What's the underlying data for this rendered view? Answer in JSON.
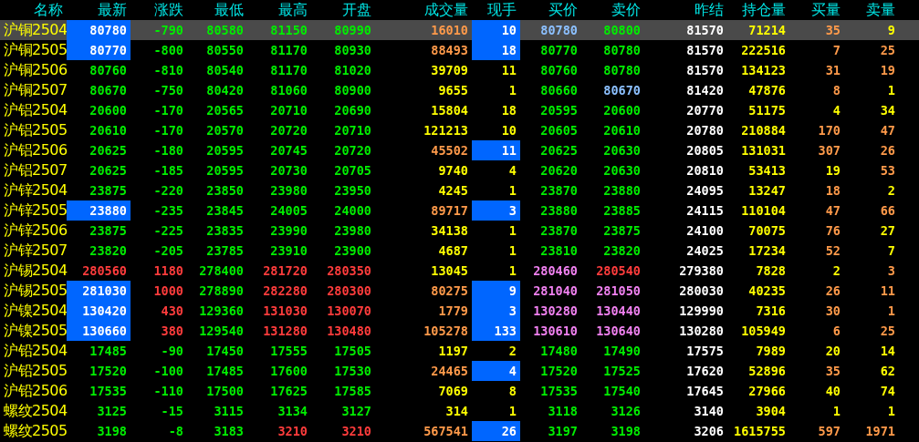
{
  "columns": [
    "名称",
    "最新",
    "涨跌",
    "最低",
    "最高",
    "开盘",
    "成交量",
    "现手",
    "买价",
    "卖价",
    "昨结",
    "持仓量",
    "买量",
    "卖量"
  ],
  "rows": [
    {
      "name": "沪铜2504",
      "selected": true,
      "cells": [
        {
          "text": "80780",
          "color": "#ffffff",
          "flash": true
        },
        {
          "text": "-790",
          "color": "#00ee00",
          "flash": false
        },
        {
          "text": "80580",
          "color": "#00ee00",
          "flash": false
        },
        {
          "text": "81150",
          "color": "#00ee00",
          "flash": false
        },
        {
          "text": "80990",
          "color": "#00ee00",
          "flash": false
        },
        {
          "text": "16010",
          "color": "#ff9a4a",
          "flash": false
        },
        {
          "text": "10",
          "color": "#ffffff",
          "flash": true
        },
        {
          "text": "80780",
          "color": "#8cc0ff",
          "flash": false
        },
        {
          "text": "80800",
          "color": "#00ee00",
          "flash": false
        },
        {
          "text": "81570",
          "color": "#ffffff",
          "flash": false
        },
        {
          "text": "71214",
          "color": "#ffff00",
          "flash": false
        },
        {
          "text": "35",
          "color": "#ff9a4a",
          "flash": false
        },
        {
          "text": "9",
          "color": "#ffff00",
          "flash": false
        }
      ]
    },
    {
      "name": "沪铜2505",
      "selected": false,
      "cells": [
        {
          "text": "80770",
          "color": "#ffffff",
          "flash": true
        },
        {
          "text": "-800",
          "color": "#00ee00",
          "flash": false
        },
        {
          "text": "80550",
          "color": "#00ee00",
          "flash": false
        },
        {
          "text": "81170",
          "color": "#00ee00",
          "flash": false
        },
        {
          "text": "80930",
          "color": "#00ee00",
          "flash": false
        },
        {
          "text": "88493",
          "color": "#ff9a4a",
          "flash": false
        },
        {
          "text": "18",
          "color": "#ffffff",
          "flash": true
        },
        {
          "text": "80770",
          "color": "#00ee00",
          "flash": false
        },
        {
          "text": "80780",
          "color": "#00ee00",
          "flash": false
        },
        {
          "text": "81570",
          "color": "#ffffff",
          "flash": false
        },
        {
          "text": "222516",
          "color": "#ffff00",
          "flash": false
        },
        {
          "text": "7",
          "color": "#ff9a4a",
          "flash": false
        },
        {
          "text": "25",
          "color": "#ff9a4a",
          "flash": false
        }
      ]
    },
    {
      "name": "沪铜2506",
      "selected": false,
      "cells": [
        {
          "text": "80760",
          "color": "#00ee00",
          "flash": false
        },
        {
          "text": "-810",
          "color": "#00ee00",
          "flash": false
        },
        {
          "text": "80540",
          "color": "#00ee00",
          "flash": false
        },
        {
          "text": "81170",
          "color": "#00ee00",
          "flash": false
        },
        {
          "text": "81020",
          "color": "#00ee00",
          "flash": false
        },
        {
          "text": "39709",
          "color": "#ffff00",
          "flash": false
        },
        {
          "text": "11",
          "color": "#ffff00",
          "flash": false
        },
        {
          "text": "80760",
          "color": "#00ee00",
          "flash": false
        },
        {
          "text": "80780",
          "color": "#00ee00",
          "flash": false
        },
        {
          "text": "81570",
          "color": "#ffffff",
          "flash": false
        },
        {
          "text": "134123",
          "color": "#ffff00",
          "flash": false
        },
        {
          "text": "31",
          "color": "#ff9a4a",
          "flash": false
        },
        {
          "text": "19",
          "color": "#ff9a4a",
          "flash": false
        }
      ]
    },
    {
      "name": "沪铜2507",
      "selected": false,
      "cells": [
        {
          "text": "80670",
          "color": "#00ee00",
          "flash": false
        },
        {
          "text": "-750",
          "color": "#00ee00",
          "flash": false
        },
        {
          "text": "80420",
          "color": "#00ee00",
          "flash": false
        },
        {
          "text": "81060",
          "color": "#00ee00",
          "flash": false
        },
        {
          "text": "80900",
          "color": "#00ee00",
          "flash": false
        },
        {
          "text": "9655",
          "color": "#ffff00",
          "flash": false
        },
        {
          "text": "1",
          "color": "#ffff00",
          "flash": false
        },
        {
          "text": "80660",
          "color": "#00ee00",
          "flash": false
        },
        {
          "text": "80670",
          "color": "#8cc0ff",
          "flash": false
        },
        {
          "text": "81420",
          "color": "#ffffff",
          "flash": false
        },
        {
          "text": "47876",
          "color": "#ffff00",
          "flash": false
        },
        {
          "text": "8",
          "color": "#ff9a4a",
          "flash": false
        },
        {
          "text": "1",
          "color": "#ffff00",
          "flash": false
        }
      ]
    },
    {
      "name": "沪铝2504",
      "selected": false,
      "cells": [
        {
          "text": "20600",
          "color": "#00ee00",
          "flash": false
        },
        {
          "text": "-170",
          "color": "#00ee00",
          "flash": false
        },
        {
          "text": "20565",
          "color": "#00ee00",
          "flash": false
        },
        {
          "text": "20710",
          "color": "#00ee00",
          "flash": false
        },
        {
          "text": "20690",
          "color": "#00ee00",
          "flash": false
        },
        {
          "text": "15804",
          "color": "#ffff00",
          "flash": false
        },
        {
          "text": "18",
          "color": "#ffff00",
          "flash": false
        },
        {
          "text": "20595",
          "color": "#00ee00",
          "flash": false
        },
        {
          "text": "20600",
          "color": "#00ee00",
          "flash": false
        },
        {
          "text": "20770",
          "color": "#ffffff",
          "flash": false
        },
        {
          "text": "51175",
          "color": "#ffff00",
          "flash": false
        },
        {
          "text": "4",
          "color": "#ffff00",
          "flash": false
        },
        {
          "text": "34",
          "color": "#ffff00",
          "flash": false
        }
      ]
    },
    {
      "name": "沪铝2505",
      "selected": false,
      "cells": [
        {
          "text": "20610",
          "color": "#00ee00",
          "flash": false
        },
        {
          "text": "-170",
          "color": "#00ee00",
          "flash": false
        },
        {
          "text": "20570",
          "color": "#00ee00",
          "flash": false
        },
        {
          "text": "20720",
          "color": "#00ee00",
          "flash": false
        },
        {
          "text": "20710",
          "color": "#00ee00",
          "flash": false
        },
        {
          "text": "121213",
          "color": "#ffff00",
          "flash": false
        },
        {
          "text": "10",
          "color": "#ffff00",
          "flash": false
        },
        {
          "text": "20605",
          "color": "#00ee00",
          "flash": false
        },
        {
          "text": "20610",
          "color": "#00ee00",
          "flash": false
        },
        {
          "text": "20780",
          "color": "#ffffff",
          "flash": false
        },
        {
          "text": "210884",
          "color": "#ffff00",
          "flash": false
        },
        {
          "text": "170",
          "color": "#ff9a4a",
          "flash": false
        },
        {
          "text": "47",
          "color": "#ff9a4a",
          "flash": false
        }
      ]
    },
    {
      "name": "沪铝2506",
      "selected": false,
      "cells": [
        {
          "text": "20625",
          "color": "#00ee00",
          "flash": false
        },
        {
          "text": "-180",
          "color": "#00ee00",
          "flash": false
        },
        {
          "text": "20595",
          "color": "#00ee00",
          "flash": false
        },
        {
          "text": "20745",
          "color": "#00ee00",
          "flash": false
        },
        {
          "text": "20720",
          "color": "#00ee00",
          "flash": false
        },
        {
          "text": "45502",
          "color": "#ff9a4a",
          "flash": false
        },
        {
          "text": "11",
          "color": "#ffffff",
          "flash": true
        },
        {
          "text": "20625",
          "color": "#00ee00",
          "flash": false
        },
        {
          "text": "20630",
          "color": "#00ee00",
          "flash": false
        },
        {
          "text": "20805",
          "color": "#ffffff",
          "flash": false
        },
        {
          "text": "131031",
          "color": "#ffff00",
          "flash": false
        },
        {
          "text": "307",
          "color": "#ff9a4a",
          "flash": false
        },
        {
          "text": "26",
          "color": "#ff9a4a",
          "flash": false
        }
      ]
    },
    {
      "name": "沪铝2507",
      "selected": false,
      "cells": [
        {
          "text": "20625",
          "color": "#00ee00",
          "flash": false
        },
        {
          "text": "-185",
          "color": "#00ee00",
          "flash": false
        },
        {
          "text": "20595",
          "color": "#00ee00",
          "flash": false
        },
        {
          "text": "20730",
          "color": "#00ee00",
          "flash": false
        },
        {
          "text": "20705",
          "color": "#00ee00",
          "flash": false
        },
        {
          "text": "9740",
          "color": "#ffff00",
          "flash": false
        },
        {
          "text": "4",
          "color": "#ffff00",
          "flash": false
        },
        {
          "text": "20620",
          "color": "#00ee00",
          "flash": false
        },
        {
          "text": "20630",
          "color": "#00ee00",
          "flash": false
        },
        {
          "text": "20810",
          "color": "#ffffff",
          "flash": false
        },
        {
          "text": "53413",
          "color": "#ffff00",
          "flash": false
        },
        {
          "text": "19",
          "color": "#ffff00",
          "flash": false
        },
        {
          "text": "53",
          "color": "#ff9a4a",
          "flash": false
        }
      ]
    },
    {
      "name": "沪锌2504",
      "selected": false,
      "cells": [
        {
          "text": "23875",
          "color": "#00ee00",
          "flash": false
        },
        {
          "text": "-220",
          "color": "#00ee00",
          "flash": false
        },
        {
          "text": "23850",
          "color": "#00ee00",
          "flash": false
        },
        {
          "text": "23980",
          "color": "#00ee00",
          "flash": false
        },
        {
          "text": "23950",
          "color": "#00ee00",
          "flash": false
        },
        {
          "text": "4245",
          "color": "#ffff00",
          "flash": false
        },
        {
          "text": "1",
          "color": "#ffff00",
          "flash": false
        },
        {
          "text": "23870",
          "color": "#00ee00",
          "flash": false
        },
        {
          "text": "23880",
          "color": "#00ee00",
          "flash": false
        },
        {
          "text": "24095",
          "color": "#ffffff",
          "flash": false
        },
        {
          "text": "13247",
          "color": "#ffff00",
          "flash": false
        },
        {
          "text": "18",
          "color": "#ff9a4a",
          "flash": false
        },
        {
          "text": "2",
          "color": "#ffff00",
          "flash": false
        }
      ]
    },
    {
      "name": "沪锌2505",
      "selected": false,
      "cells": [
        {
          "text": "23880",
          "color": "#ffffff",
          "flash": true
        },
        {
          "text": "-235",
          "color": "#00ee00",
          "flash": false
        },
        {
          "text": "23845",
          "color": "#00ee00",
          "flash": false
        },
        {
          "text": "24005",
          "color": "#00ee00",
          "flash": false
        },
        {
          "text": "24000",
          "color": "#00ee00",
          "flash": false
        },
        {
          "text": "89717",
          "color": "#ff9a4a",
          "flash": false
        },
        {
          "text": "3",
          "color": "#ffffff",
          "flash": true
        },
        {
          "text": "23880",
          "color": "#00ee00",
          "flash": false
        },
        {
          "text": "23885",
          "color": "#00ee00",
          "flash": false
        },
        {
          "text": "24115",
          "color": "#ffffff",
          "flash": false
        },
        {
          "text": "110104",
          "color": "#ffff00",
          "flash": false
        },
        {
          "text": "47",
          "color": "#ff9a4a",
          "flash": false
        },
        {
          "text": "66",
          "color": "#ff9a4a",
          "flash": false
        }
      ]
    },
    {
      "name": "沪锌2506",
      "selected": false,
      "cells": [
        {
          "text": "23875",
          "color": "#00ee00",
          "flash": false
        },
        {
          "text": "-225",
          "color": "#00ee00",
          "flash": false
        },
        {
          "text": "23835",
          "color": "#00ee00",
          "flash": false
        },
        {
          "text": "23990",
          "color": "#00ee00",
          "flash": false
        },
        {
          "text": "23980",
          "color": "#00ee00",
          "flash": false
        },
        {
          "text": "34138",
          "color": "#ffff00",
          "flash": false
        },
        {
          "text": "1",
          "color": "#ffff00",
          "flash": false
        },
        {
          "text": "23870",
          "color": "#00ee00",
          "flash": false
        },
        {
          "text": "23875",
          "color": "#00ee00",
          "flash": false
        },
        {
          "text": "24100",
          "color": "#ffffff",
          "flash": false
        },
        {
          "text": "70075",
          "color": "#ffff00",
          "flash": false
        },
        {
          "text": "76",
          "color": "#ff9a4a",
          "flash": false
        },
        {
          "text": "27",
          "color": "#ffff00",
          "flash": false
        }
      ]
    },
    {
      "name": "沪锌2507",
      "selected": false,
      "cells": [
        {
          "text": "23820",
          "color": "#00ee00",
          "flash": false
        },
        {
          "text": "-205",
          "color": "#00ee00",
          "flash": false
        },
        {
          "text": "23785",
          "color": "#00ee00",
          "flash": false
        },
        {
          "text": "23910",
          "color": "#00ee00",
          "flash": false
        },
        {
          "text": "23900",
          "color": "#00ee00",
          "flash": false
        },
        {
          "text": "4687",
          "color": "#ffff00",
          "flash": false
        },
        {
          "text": "1",
          "color": "#ffff00",
          "flash": false
        },
        {
          "text": "23810",
          "color": "#00ee00",
          "flash": false
        },
        {
          "text": "23820",
          "color": "#00ee00",
          "flash": false
        },
        {
          "text": "24025",
          "color": "#ffffff",
          "flash": false
        },
        {
          "text": "17234",
          "color": "#ffff00",
          "flash": false
        },
        {
          "text": "52",
          "color": "#ff9a4a",
          "flash": false
        },
        {
          "text": "7",
          "color": "#ffff00",
          "flash": false
        }
      ]
    },
    {
      "name": "沪锡2504",
      "selected": false,
      "cells": [
        {
          "text": "280560",
          "color": "#ff3c3c",
          "flash": false
        },
        {
          "text": "1180",
          "color": "#ff3c3c",
          "flash": false
        },
        {
          "text": "278400",
          "color": "#00ee00",
          "flash": false
        },
        {
          "text": "281720",
          "color": "#ff3c3c",
          "flash": false
        },
        {
          "text": "280350",
          "color": "#ff3c3c",
          "flash": false
        },
        {
          "text": "13045",
          "color": "#ffff00",
          "flash": false
        },
        {
          "text": "1",
          "color": "#ffff00",
          "flash": false
        },
        {
          "text": "280460",
          "color": "#f080f0",
          "flash": false
        },
        {
          "text": "280540",
          "color": "#ff3c3c",
          "flash": false
        },
        {
          "text": "279380",
          "color": "#ffffff",
          "flash": false
        },
        {
          "text": "7828",
          "color": "#ffff00",
          "flash": false
        },
        {
          "text": "2",
          "color": "#ffff00",
          "flash": false
        },
        {
          "text": "3",
          "color": "#ff9a4a",
          "flash": false
        }
      ]
    },
    {
      "name": "沪锡2505",
      "selected": false,
      "cells": [
        {
          "text": "281030",
          "color": "#ffffff",
          "flash": true
        },
        {
          "text": "1000",
          "color": "#ff3c3c",
          "flash": false
        },
        {
          "text": "278890",
          "color": "#00ee00",
          "flash": false
        },
        {
          "text": "282280",
          "color": "#ff3c3c",
          "flash": false
        },
        {
          "text": "280300",
          "color": "#ff3c3c",
          "flash": false
        },
        {
          "text": "80275",
          "color": "#ff9a4a",
          "flash": false
        },
        {
          "text": "9",
          "color": "#ffffff",
          "flash": true
        },
        {
          "text": "281040",
          "color": "#f080f0",
          "flash": false
        },
        {
          "text": "281050",
          "color": "#f080f0",
          "flash": false
        },
        {
          "text": "280030",
          "color": "#ffffff",
          "flash": false
        },
        {
          "text": "40235",
          "color": "#ffff00",
          "flash": false
        },
        {
          "text": "26",
          "color": "#ff9a4a",
          "flash": false
        },
        {
          "text": "11",
          "color": "#ff9a4a",
          "flash": false
        }
      ]
    },
    {
      "name": "沪镍2504",
      "selected": false,
      "cells": [
        {
          "text": "130420",
          "color": "#ffffff",
          "flash": true
        },
        {
          "text": "430",
          "color": "#ff3c3c",
          "flash": false
        },
        {
          "text": "129360",
          "color": "#00ee00",
          "flash": false
        },
        {
          "text": "131030",
          "color": "#ff3c3c",
          "flash": false
        },
        {
          "text": "130070",
          "color": "#ff3c3c",
          "flash": false
        },
        {
          "text": "1779",
          "color": "#ff9a4a",
          "flash": false
        },
        {
          "text": "3",
          "color": "#ffffff",
          "flash": true
        },
        {
          "text": "130280",
          "color": "#f080f0",
          "flash": false
        },
        {
          "text": "130440",
          "color": "#f080f0",
          "flash": false
        },
        {
          "text": "129990",
          "color": "#ffffff",
          "flash": false
        },
        {
          "text": "7316",
          "color": "#ffff00",
          "flash": false
        },
        {
          "text": "30",
          "color": "#ff9a4a",
          "flash": false
        },
        {
          "text": "1",
          "color": "#ff9a4a",
          "flash": false
        }
      ]
    },
    {
      "name": "沪镍2505",
      "selected": false,
      "cells": [
        {
          "text": "130660",
          "color": "#ffffff",
          "flash": true
        },
        {
          "text": "380",
          "color": "#ff3c3c",
          "flash": false
        },
        {
          "text": "129540",
          "color": "#00ee00",
          "flash": false
        },
        {
          "text": "131280",
          "color": "#ff3c3c",
          "flash": false
        },
        {
          "text": "130480",
          "color": "#ff3c3c",
          "flash": false
        },
        {
          "text": "105278",
          "color": "#ff9a4a",
          "flash": false
        },
        {
          "text": "133",
          "color": "#ffffff",
          "flash": true
        },
        {
          "text": "130610",
          "color": "#f080f0",
          "flash": false
        },
        {
          "text": "130640",
          "color": "#f080f0",
          "flash": false
        },
        {
          "text": "130280",
          "color": "#ffffff",
          "flash": false
        },
        {
          "text": "105949",
          "color": "#ffff00",
          "flash": false
        },
        {
          "text": "6",
          "color": "#ff9a4a",
          "flash": false
        },
        {
          "text": "25",
          "color": "#ff9a4a",
          "flash": false
        }
      ]
    },
    {
      "name": "沪铅2504",
      "selected": false,
      "cells": [
        {
          "text": "17485",
          "color": "#00ee00",
          "flash": false
        },
        {
          "text": "-90",
          "color": "#00ee00",
          "flash": false
        },
        {
          "text": "17450",
          "color": "#00ee00",
          "flash": false
        },
        {
          "text": "17555",
          "color": "#00ee00",
          "flash": false
        },
        {
          "text": "17505",
          "color": "#00ee00",
          "flash": false
        },
        {
          "text": "1197",
          "color": "#ffff00",
          "flash": false
        },
        {
          "text": "2",
          "color": "#ffff00",
          "flash": false
        },
        {
          "text": "17480",
          "color": "#00ee00",
          "flash": false
        },
        {
          "text": "17490",
          "color": "#00ee00",
          "flash": false
        },
        {
          "text": "17575",
          "color": "#ffffff",
          "flash": false
        },
        {
          "text": "7989",
          "color": "#ffff00",
          "flash": false
        },
        {
          "text": "20",
          "color": "#ffff00",
          "flash": false
        },
        {
          "text": "14",
          "color": "#ffff00",
          "flash": false
        }
      ]
    },
    {
      "name": "沪铅2505",
      "selected": false,
      "cells": [
        {
          "text": "17520",
          "color": "#00ee00",
          "flash": false
        },
        {
          "text": "-100",
          "color": "#00ee00",
          "flash": false
        },
        {
          "text": "17485",
          "color": "#00ee00",
          "flash": false
        },
        {
          "text": "17600",
          "color": "#00ee00",
          "flash": false
        },
        {
          "text": "17530",
          "color": "#00ee00",
          "flash": false
        },
        {
          "text": "24465",
          "color": "#ff9a4a",
          "flash": false
        },
        {
          "text": "4",
          "color": "#ffffff",
          "flash": true
        },
        {
          "text": "17520",
          "color": "#00ee00",
          "flash": false
        },
        {
          "text": "17525",
          "color": "#00ee00",
          "flash": false
        },
        {
          "text": "17620",
          "color": "#ffffff",
          "flash": false
        },
        {
          "text": "52896",
          "color": "#ffff00",
          "flash": false
        },
        {
          "text": "35",
          "color": "#ff9a4a",
          "flash": false
        },
        {
          "text": "62",
          "color": "#ffff00",
          "flash": false
        }
      ]
    },
    {
      "name": "沪铅2506",
      "selected": false,
      "cells": [
        {
          "text": "17535",
          "color": "#00ee00",
          "flash": false
        },
        {
          "text": "-110",
          "color": "#00ee00",
          "flash": false
        },
        {
          "text": "17500",
          "color": "#00ee00",
          "flash": false
        },
        {
          "text": "17625",
          "color": "#00ee00",
          "flash": false
        },
        {
          "text": "17585",
          "color": "#00ee00",
          "flash": false
        },
        {
          "text": "7069",
          "color": "#ffff00",
          "flash": false
        },
        {
          "text": "8",
          "color": "#ffff00",
          "flash": false
        },
        {
          "text": "17535",
          "color": "#00ee00",
          "flash": false
        },
        {
          "text": "17540",
          "color": "#00ee00",
          "flash": false
        },
        {
          "text": "17645",
          "color": "#ffffff",
          "flash": false
        },
        {
          "text": "27966",
          "color": "#ffff00",
          "flash": false
        },
        {
          "text": "40",
          "color": "#ffff00",
          "flash": false
        },
        {
          "text": "74",
          "color": "#ffff00",
          "flash": false
        }
      ]
    },
    {
      "name": "螺纹2504",
      "selected": false,
      "cells": [
        {
          "text": "3125",
          "color": "#00ee00",
          "flash": false
        },
        {
          "text": "-15",
          "color": "#00ee00",
          "flash": false
        },
        {
          "text": "3115",
          "color": "#00ee00",
          "flash": false
        },
        {
          "text": "3134",
          "color": "#00ee00",
          "flash": false
        },
        {
          "text": "3127",
          "color": "#00ee00",
          "flash": false
        },
        {
          "text": "314",
          "color": "#ffff00",
          "flash": false
        },
        {
          "text": "1",
          "color": "#ffff00",
          "flash": false
        },
        {
          "text": "3118",
          "color": "#00ee00",
          "flash": false
        },
        {
          "text": "3126",
          "color": "#00ee00",
          "flash": false
        },
        {
          "text": "3140",
          "color": "#ffffff",
          "flash": false
        },
        {
          "text": "3904",
          "color": "#ffff00",
          "flash": false
        },
        {
          "text": "1",
          "color": "#ffff00",
          "flash": false
        },
        {
          "text": "1",
          "color": "#ffff00",
          "flash": false
        }
      ]
    },
    {
      "name": "螺纹2505",
      "selected": false,
      "cells": [
        {
          "text": "3198",
          "color": "#00ee00",
          "flash": false
        },
        {
          "text": "-8",
          "color": "#00ee00",
          "flash": false
        },
        {
          "text": "3183",
          "color": "#00ee00",
          "flash": false
        },
        {
          "text": "3210",
          "color": "#ff3c3c",
          "flash": false
        },
        {
          "text": "3210",
          "color": "#ff3c3c",
          "flash": false
        },
        {
          "text": "567541",
          "color": "#ff9a4a",
          "flash": false
        },
        {
          "text": "26",
          "color": "#ffffff",
          "flash": true
        },
        {
          "text": "3197",
          "color": "#00ee00",
          "flash": false
        },
        {
          "text": "3198",
          "color": "#00ee00",
          "flash": false
        },
        {
          "text": "3206",
          "color": "#ffffff",
          "flash": false
        },
        {
          "text": "1615755",
          "color": "#ffff00",
          "flash": false
        },
        {
          "text": "597",
          "color": "#ff9a4a",
          "flash": false
        },
        {
          "text": "1971",
          "color": "#ff9a4a",
          "flash": false
        }
      ]
    }
  ]
}
